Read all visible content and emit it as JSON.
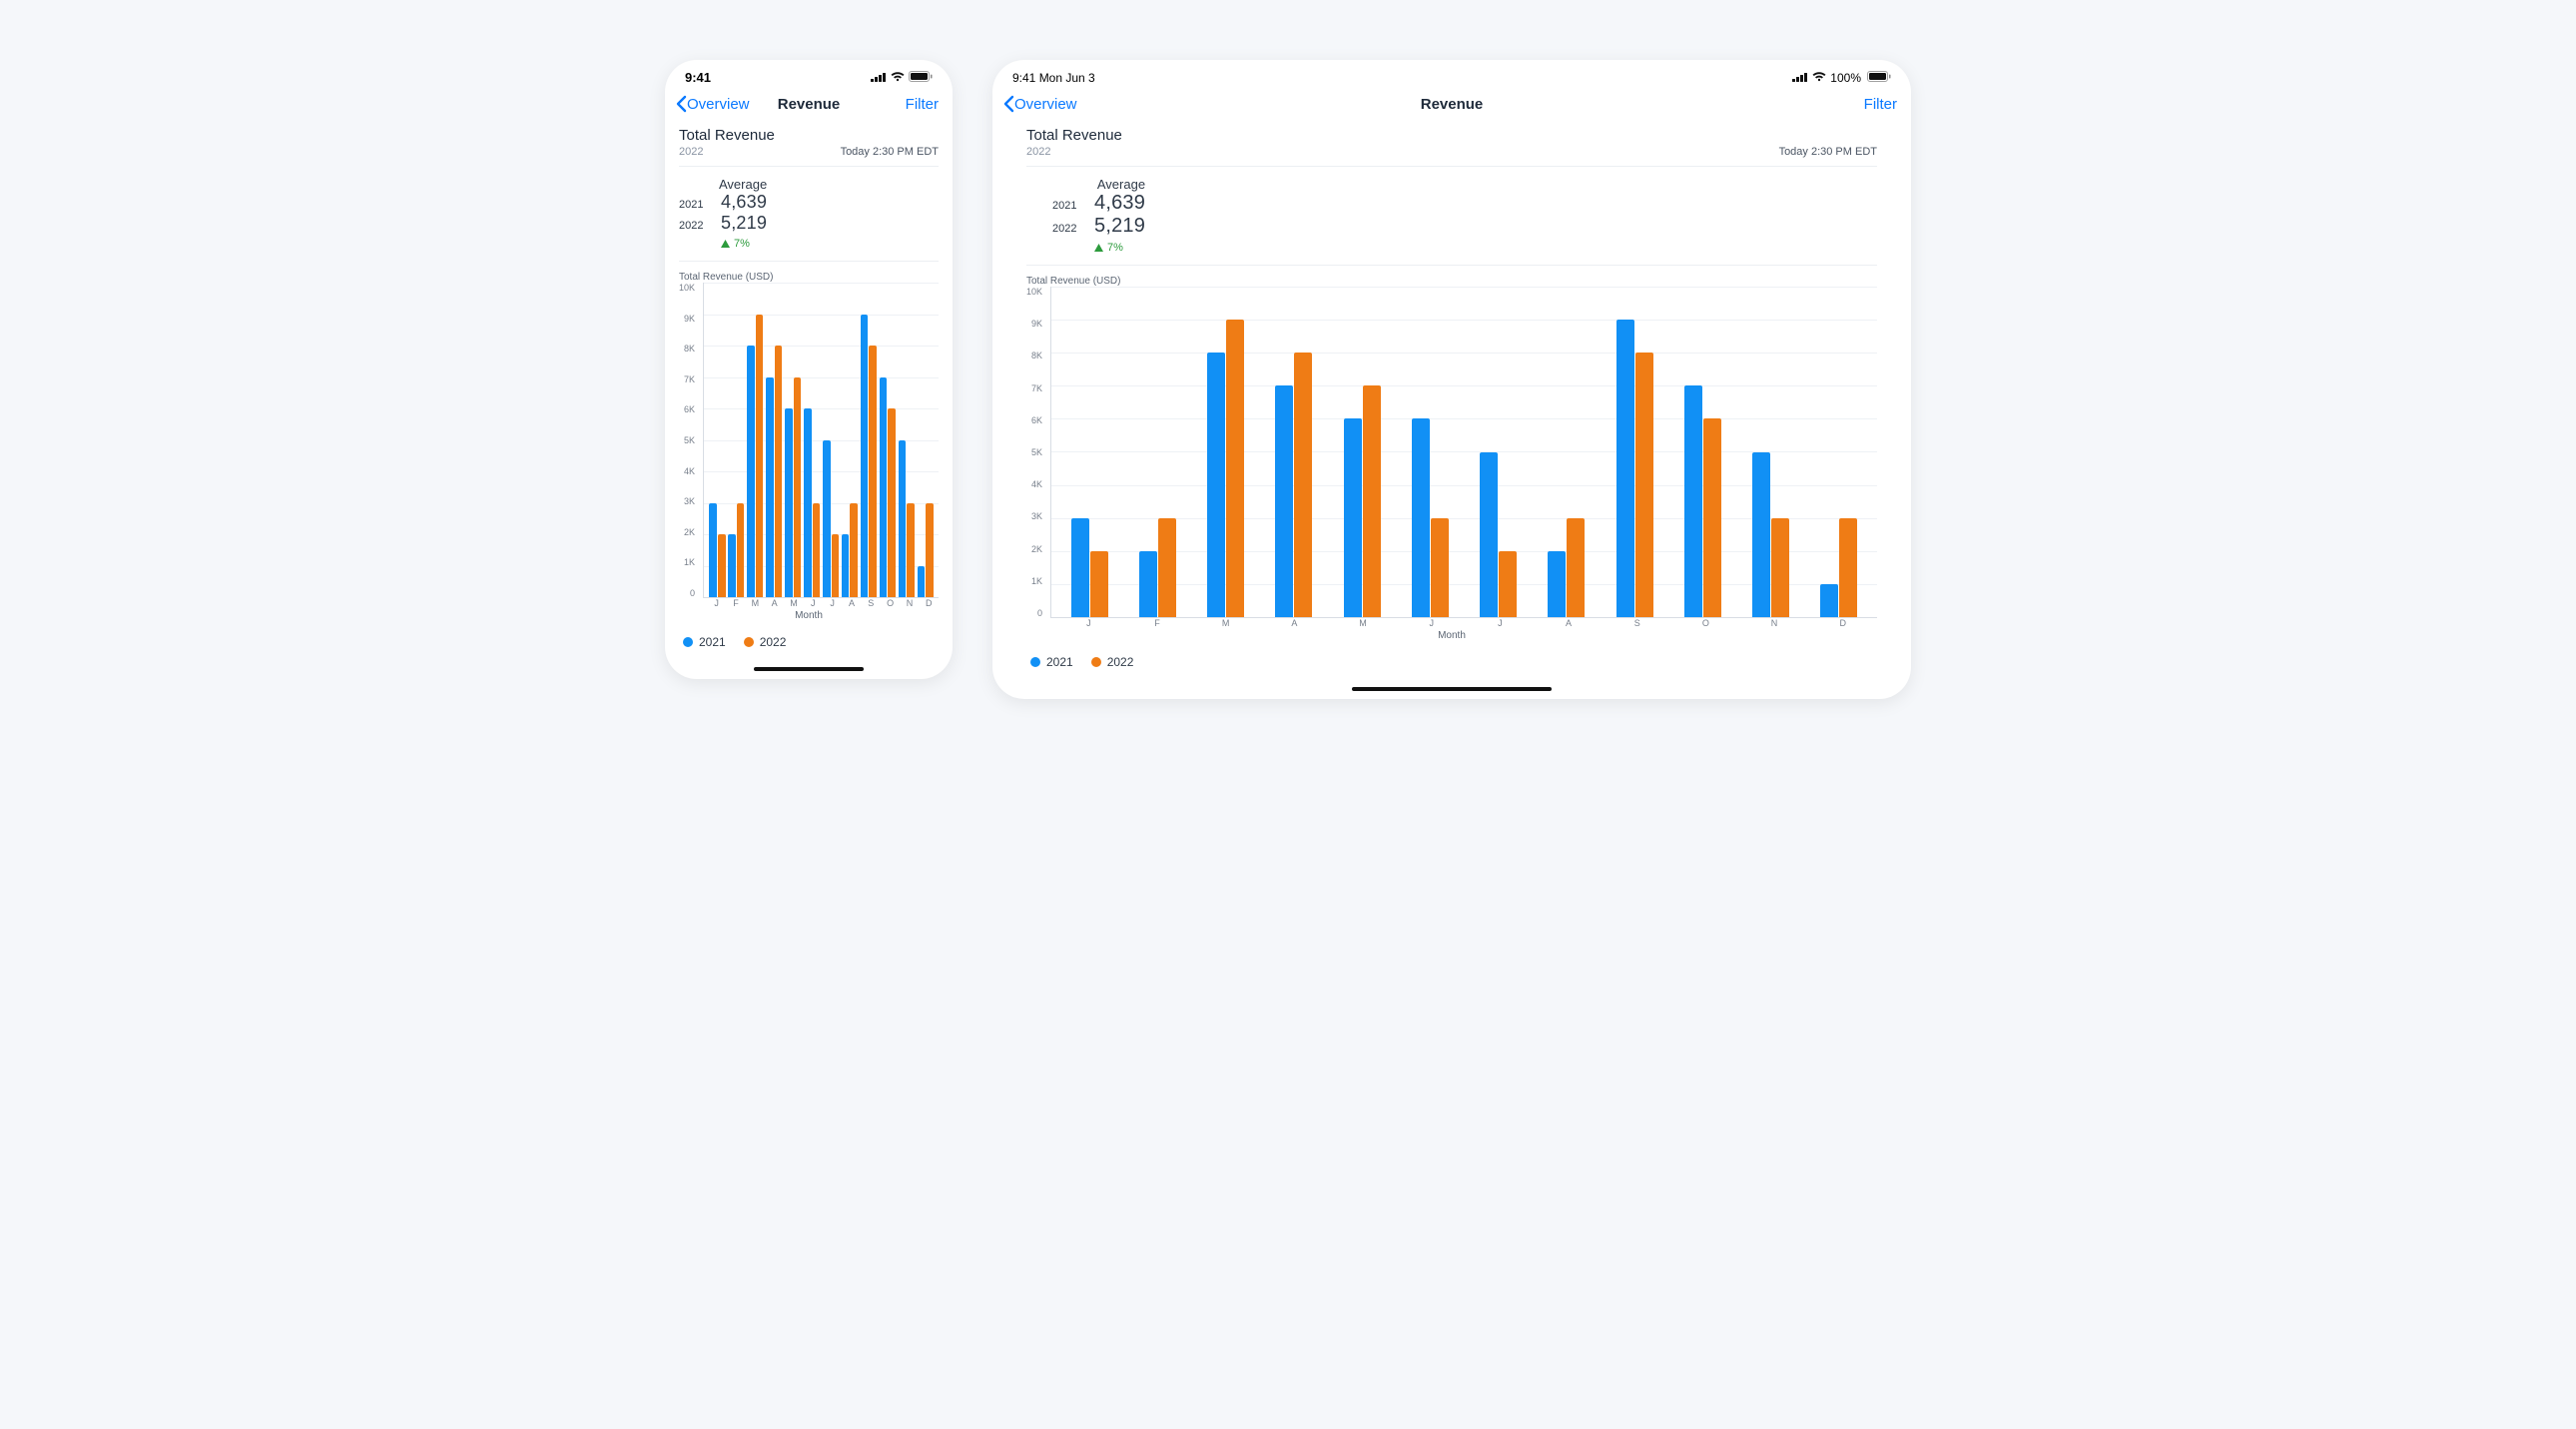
{
  "status": {
    "time_phone": "9:41",
    "time_tablet": "9:41 Mon Jun 3",
    "battery_pct": "100%"
  },
  "nav": {
    "back_label": "Overview",
    "title": "Revenue",
    "filter_label": "Filter"
  },
  "header": {
    "title": "Total Revenue",
    "subtitle": "2022",
    "timestamp": "Today 2:30 PM EDT"
  },
  "averages": {
    "label": "Average",
    "rows": [
      {
        "year": "2021",
        "value": "4,639"
      },
      {
        "year": "2022",
        "value": "5,219"
      }
    ],
    "delta": "7%"
  },
  "chart_meta": {
    "title": "Total Revenue (USD)",
    "xlabel": "Month"
  },
  "legend": {
    "a": "2021",
    "b": "2022"
  },
  "chart_data": {
    "type": "bar",
    "title": "Total Revenue (USD)",
    "xlabel": "Month",
    "ylabel": "",
    "ylim": [
      0,
      10000
    ],
    "yticks": [
      "0",
      "1K",
      "2K",
      "3K",
      "4K",
      "5K",
      "6K",
      "7K",
      "8K",
      "9K",
      "10K"
    ],
    "categories": [
      "J",
      "F",
      "M",
      "A",
      "M",
      "J",
      "J",
      "A",
      "S",
      "O",
      "N",
      "D"
    ],
    "series": [
      {
        "name": "2021",
        "color": "#1190f5",
        "values": [
          3000,
          2000,
          8000,
          7000,
          6000,
          6000,
          5000,
          2000,
          9000,
          7000,
          5000,
          1000
        ]
      },
      {
        "name": "2022",
        "color": "#ef7c15",
        "values": [
          2000,
          3000,
          9000,
          8000,
          7000,
          3000,
          2000,
          3000,
          8000,
          6000,
          3000,
          3000
        ]
      }
    ]
  }
}
